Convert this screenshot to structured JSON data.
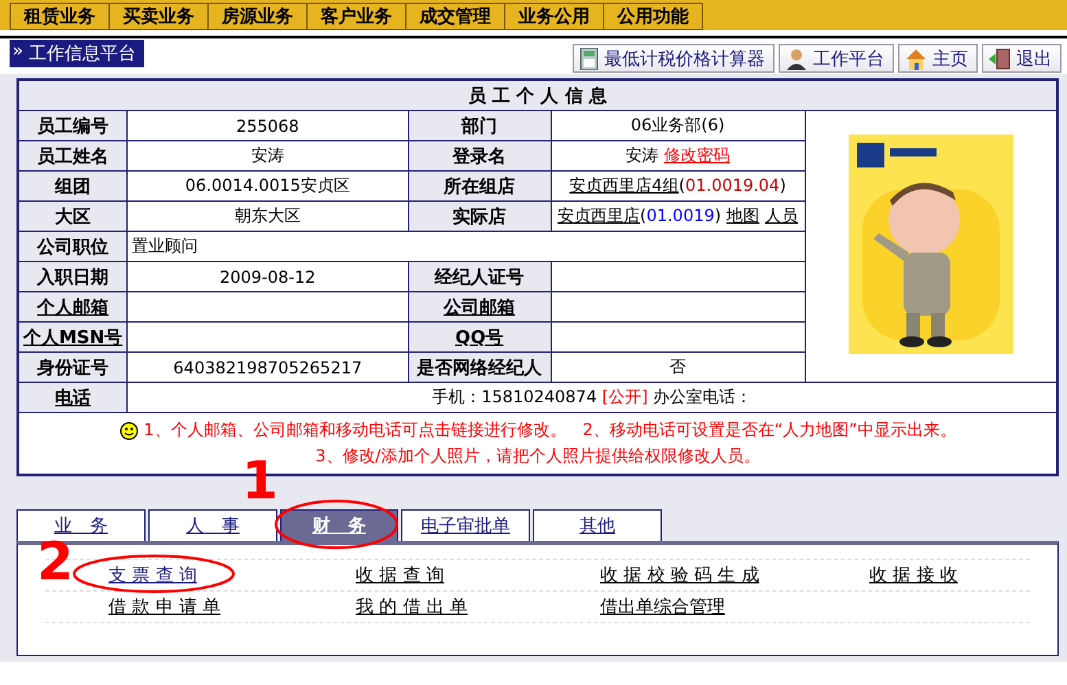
{
  "menu": [
    {
      "label": "租赁业务"
    },
    {
      "label": "买卖业务"
    },
    {
      "label": "房源业务"
    },
    {
      "label": "客户业务"
    },
    {
      "label": "成交管理"
    },
    {
      "label": "业务公用"
    },
    {
      "label": "公用功能"
    }
  ],
  "platform_marker": "»",
  "platform_label": "工作信息平台",
  "toolbar": [
    {
      "label": "最低计税价格计算器",
      "kind": "calculator"
    },
    {
      "label": "工作平台",
      "kind": "person"
    },
    {
      "label": "主页",
      "kind": "home"
    },
    {
      "label": "退出",
      "kind": "exit"
    }
  ],
  "info": {
    "title": "员 工 个 人 信 息",
    "rows": [
      {
        "kind": "pair",
        "label": "员工编号",
        "label_link": false,
        "value": "255068",
        "label2": "部门",
        "label2_link": false,
        "value2": [
          {
            "text": "06业务部(6)",
            "kind": "text"
          }
        ]
      },
      {
        "kind": "pair",
        "label": "员工姓名",
        "label_link": false,
        "value": "安涛",
        "label2": "登录名",
        "label2_link": false,
        "value2": [
          {
            "text": "安涛 ",
            "kind": "text"
          },
          {
            "text": "修改密码",
            "kind": "warn-link"
          }
        ]
      },
      {
        "kind": "pair",
        "label": "组团",
        "label_link": false,
        "value": "06.0014.0015安贞区",
        "label2": "所在组店",
        "label2_link": false,
        "value2": [
          {
            "text": "安贞西里店4组",
            "kind": "link"
          },
          {
            "text": "(",
            "kind": "text"
          },
          {
            "text": "01.0019.04",
            "kind": "code",
            "color": "#cc0000"
          },
          {
            "text": ")",
            "kind": "text"
          }
        ]
      },
      {
        "kind": "pair",
        "label": "大区",
        "label_link": false,
        "value": "朝东大区",
        "label2": "实际店",
        "label2_link": false,
        "value2": [
          {
            "text": "安贞西里店",
            "kind": "link"
          },
          {
            "text": "(",
            "kind": "text"
          },
          {
            "text": "01.0019",
            "kind": "code",
            "color": "#0000ff"
          },
          {
            "text": ")",
            "kind": "text"
          },
          {
            "text": "地图",
            "kind": "link"
          },
          {
            "text": "人员",
            "kind": "link"
          }
        ]
      },
      {
        "kind": "wide",
        "label": "公司职位",
        "label_link": false,
        "value": "置业顾问"
      },
      {
        "kind": "pair",
        "label": "入职日期",
        "label_link": false,
        "value": "2009-08-12",
        "label2": "经纪人证号",
        "label2_link": false,
        "value2": []
      },
      {
        "kind": "pair",
        "label": "个人邮箱",
        "label_link": true,
        "value": "",
        "label2": "公司邮箱",
        "label2_link": true,
        "value2": []
      },
      {
        "kind": "pair",
        "label": "个人MSN号",
        "label_link": true,
        "value": "",
        "label2": "QQ号",
        "label2_link": true,
        "value2": []
      },
      {
        "kind": "pair",
        "label": "身份证号",
        "label_link": false,
        "value": "640382198705265217",
        "label2": "是否网络经纪人",
        "label2_link": false,
        "value2": [
          {
            "text": "否",
            "kind": "text"
          }
        ]
      }
    ],
    "phone": {
      "label": "电话",
      "parts": [
        {
          "text": "手机：15810240874 "
        },
        {
          "text": "[公开]",
          "color": "#ff0000"
        },
        {
          "text": " 办公室电话："
        }
      ]
    },
    "notes": [
      "1、个人邮箱、公司邮箱和移动电话可点击链接进行修改。　2、移动电话可设置是否在“人力地图”中显示出来。",
      "3、修改/添加个人照片，请把个人照片提供给权限修改人员。"
    ]
  },
  "tabs": [
    {
      "label": "业　务",
      "selected": false
    },
    {
      "label": "人　事",
      "selected": false
    },
    {
      "label": "财　务",
      "selected": true
    },
    {
      "label": "电子审批单",
      "selected": false
    },
    {
      "label": "其他",
      "selected": false
    }
  ],
  "links": [
    [
      {
        "label": "支 票 查 询",
        "visited": true
      },
      {
        "label": "收 据 查 询",
        "visited": false
      },
      {
        "label": "收 据 校 验 码 生 成",
        "visited": false
      },
      {
        "label": "收 据 接 收",
        "visited": false
      }
    ],
    [
      {
        "label": "借 款 申 请 单",
        "visited": false
      },
      {
        "label": "我 的 借 出 单",
        "visited": false
      },
      {
        "label": "借出单综合管理",
        "visited": false
      }
    ]
  ],
  "annotations": [
    {
      "number": "1"
    },
    {
      "number": "2"
    }
  ]
}
